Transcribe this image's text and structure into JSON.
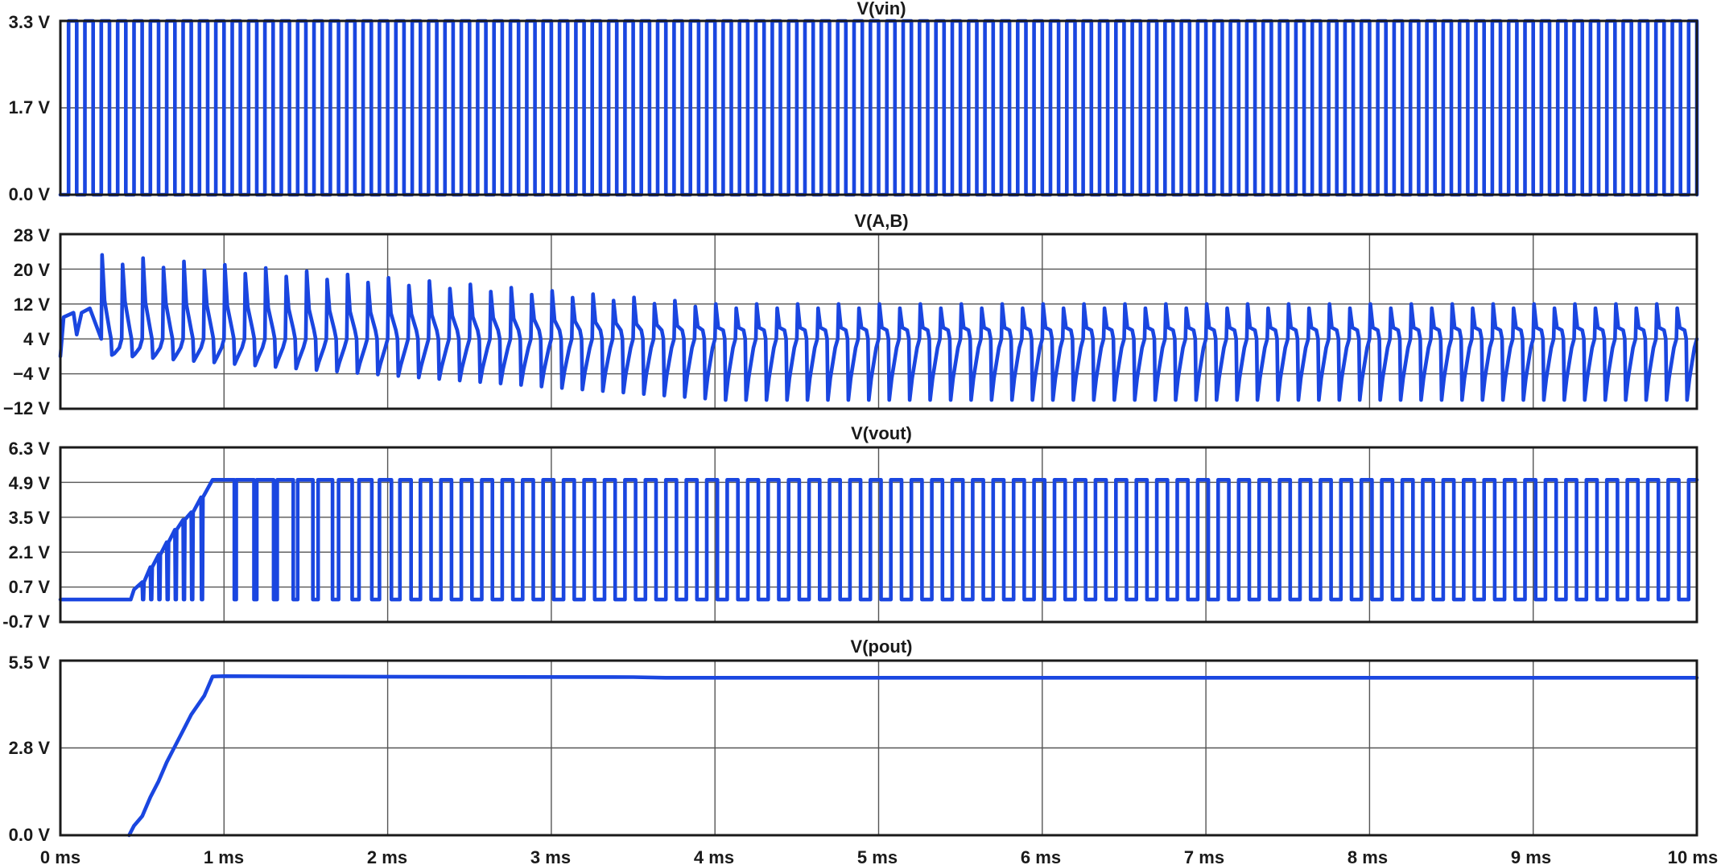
{
  "chart_data": [
    {
      "type": "line",
      "title": "V(vin)",
      "ylim": [
        0,
        3.3
      ],
      "y_ticks": [
        "3.3 V",
        "1.7 V",
        "0.0 V"
      ],
      "y_tick_values": [
        3.3,
        1.65,
        0
      ],
      "xlim": [
        0,
        10
      ],
      "x_grid_major": [
        1,
        2,
        3,
        4,
        5,
        6,
        7,
        8,
        9
      ],
      "signal": {
        "kind": "square",
        "low": 0,
        "high": 3.3,
        "period_ms": 0.1,
        "start_ms": 0.05,
        "duty": 0.5
      }
    },
    {
      "type": "line",
      "title": "V(A,B)",
      "ylim": [
        -12,
        28
      ],
      "y_ticks": [
        "28 V",
        "20 V",
        "12 V",
        "4 V",
        "−4 V",
        "−12 V"
      ],
      "y_tick_values": [
        28,
        20,
        12,
        4,
        -4,
        -12
      ],
      "xlim": [
        0,
        10
      ],
      "signal": {
        "kind": "spike_train",
        "period_ms": 0.125,
        "start_ms": 0.25,
        "early_levels": [
          10,
          10,
          8,
          11,
          7,
          10,
          9
        ],
        "peak_early": 24,
        "peak_late": 12,
        "trough_early": 1,
        "trough_late": -10,
        "settle_high": 4,
        "settle_low": -2
      }
    },
    {
      "type": "line",
      "title": "V(vout)",
      "ylim": [
        -0.7,
        6.3
      ],
      "y_ticks": [
        "6.3 V",
        "4.9 V",
        "3.5 V",
        "2.1 V",
        "0.7 V",
        "-0.7 V"
      ],
      "y_tick_values": [
        6.3,
        4.9,
        3.5,
        2.1,
        0.7,
        -0.7
      ],
      "xlim": [
        0,
        10
      ],
      "signal": {
        "kind": "ramp_then_square",
        "low": 0.2,
        "high": 5.0,
        "ramp_start_ms": 0.43,
        "ramp_end_ms": 0.93,
        "period_ms": 0.125
      }
    },
    {
      "type": "line",
      "title": "V(pout)",
      "ylim": [
        0,
        5.5
      ],
      "y_ticks": [
        "5.5 V",
        "2.8 V",
        "0.0 V"
      ],
      "y_tick_values": [
        5.5,
        2.75,
        0
      ],
      "xlim": [
        0,
        10
      ],
      "x_ticks": [
        "0 ms",
        "1 ms",
        "2 ms",
        "3 ms",
        "4 ms",
        "5 ms",
        "6 ms",
        "7 ms",
        "8 ms",
        "9 ms",
        "10 ms"
      ],
      "x_tick_values": [
        0,
        1,
        2,
        3,
        4,
        5,
        6,
        7,
        8,
        9,
        10
      ],
      "signal": {
        "kind": "ramp_then_hold",
        "points": [
          [
            0.42,
            0
          ],
          [
            0.45,
            0.3
          ],
          [
            0.5,
            0.6
          ],
          [
            0.55,
            1.2
          ],
          [
            0.6,
            1.7
          ],
          [
            0.65,
            2.3
          ],
          [
            0.7,
            2.8
          ],
          [
            0.75,
            3.3
          ],
          [
            0.8,
            3.8
          ],
          [
            0.88,
            4.4
          ],
          [
            0.93,
            5.0
          ],
          [
            1.0,
            5.01
          ],
          [
            1.5,
            5.0
          ],
          [
            2.2,
            4.99
          ],
          [
            3.5,
            4.98
          ],
          [
            3.7,
            4.96
          ],
          [
            6.0,
            4.96
          ],
          [
            10,
            4.96
          ]
        ]
      }
    }
  ],
  "colors": {
    "trace": "#1a46e0",
    "grid": "#555555",
    "frame": "#1a1a1a",
    "background": "#ffffff"
  }
}
